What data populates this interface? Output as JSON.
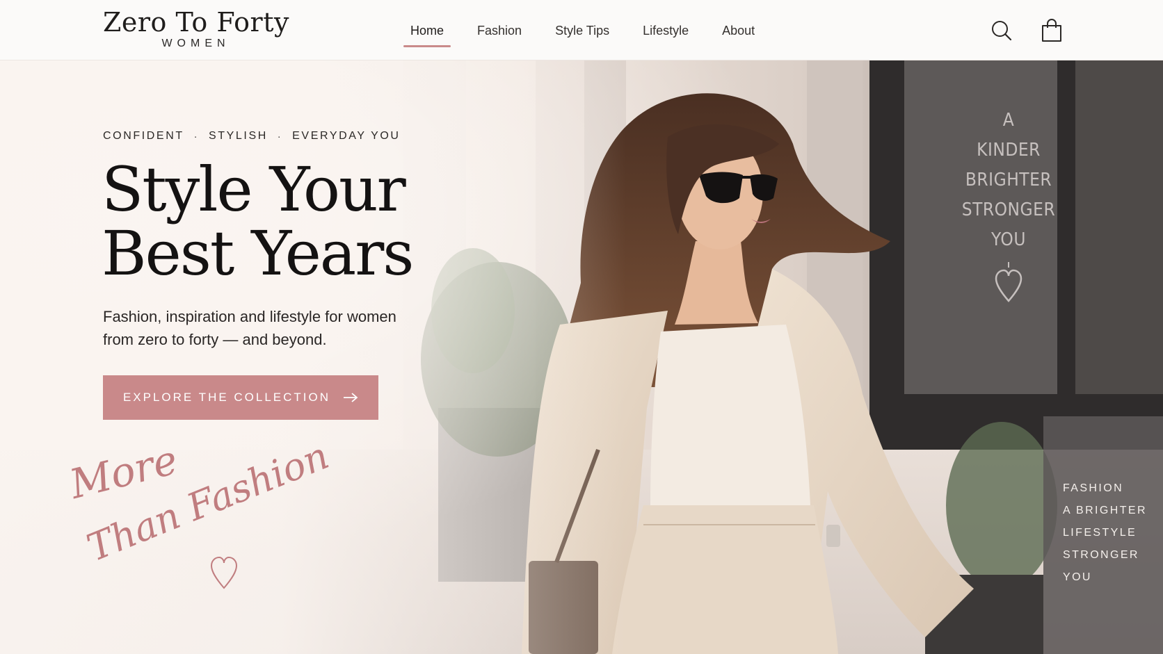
{
  "brand": {
    "name": "Zero To Forty",
    "subtitle": "WOMEN"
  },
  "nav": {
    "items": [
      {
        "label": "Home",
        "active": true
      },
      {
        "label": "Fashion",
        "active": false
      },
      {
        "label": "Style Tips",
        "active": false
      },
      {
        "label": "Lifestyle",
        "active": false
      },
      {
        "label": "About",
        "active": false
      }
    ],
    "icons": [
      "search-icon",
      "shopping-bag-icon"
    ]
  },
  "hero": {
    "tagline": [
      "CONFIDENT",
      "STYLISH",
      "EVERYDAY YOU"
    ],
    "tagline_separator": "·",
    "headline_line1": "Style Your",
    "headline_line2": "Best Years",
    "subcopy": "Fashion, inspiration and lifestyle for women from zero to forty — and beyond.",
    "cta_label": "EXPLORE THE COLLECTION",
    "script_line1": "More",
    "script_line2": "Than Fashion",
    "window_text": [
      "A",
      "KINDER",
      "BRIGHTER",
      "STRONGER",
      "YOU"
    ],
    "side_text": [
      "FASHION",
      "A BRIGHTER",
      "LIFESTYLE",
      "STRONGER",
      "YOU"
    ]
  },
  "colors": {
    "accent": "#c9898a",
    "nav_underline": "#c98a8a",
    "script": "#c07d7f",
    "header_bg": "#fbfaf9"
  }
}
